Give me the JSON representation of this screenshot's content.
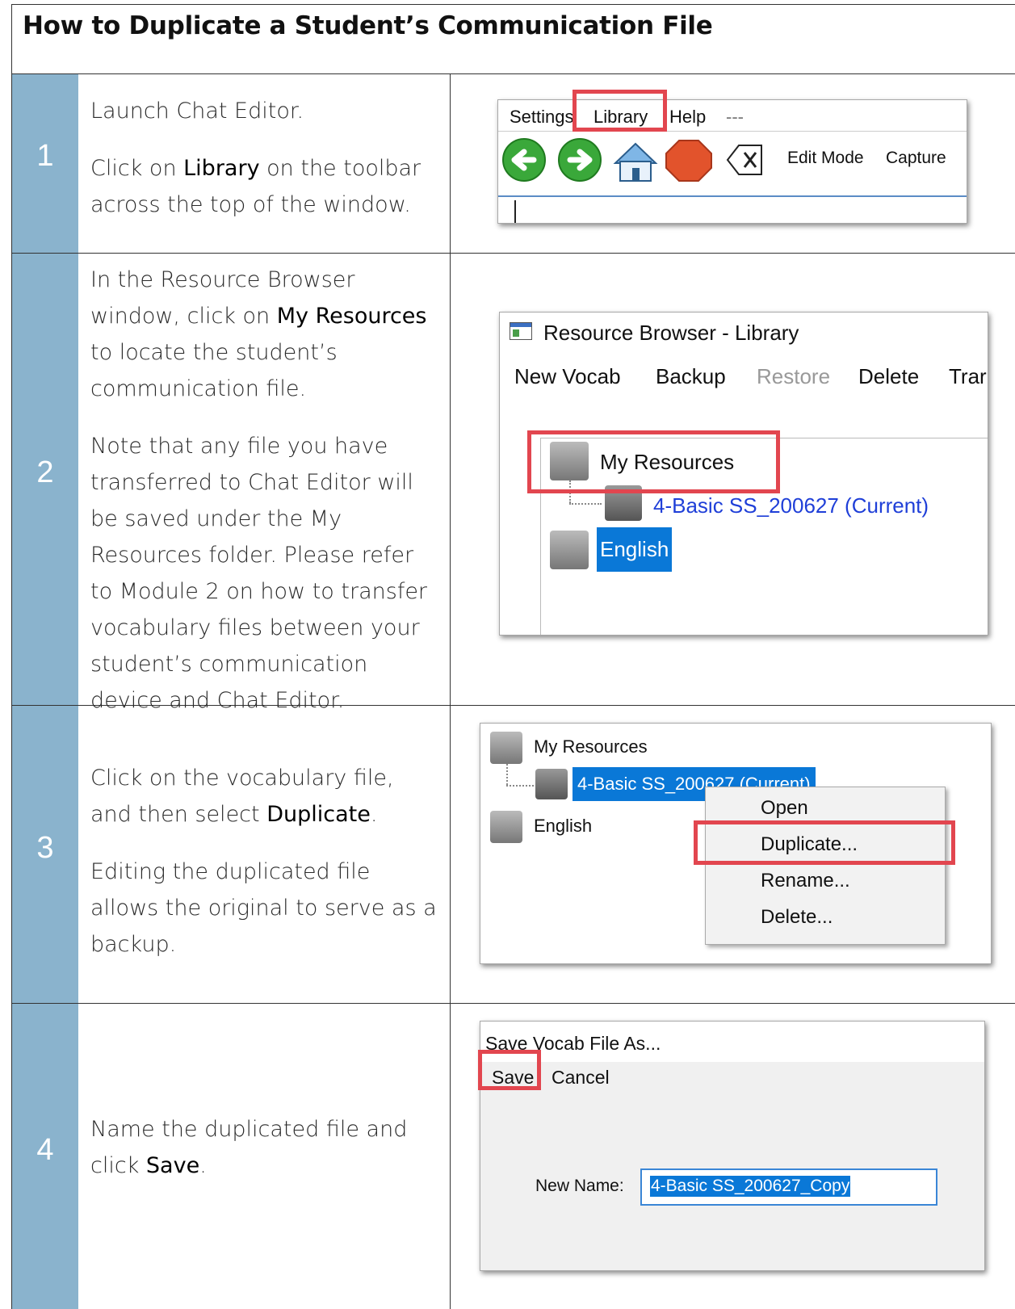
{
  "title": "How to Duplicate a Student’s Communication File",
  "steps": [
    {
      "number": "1",
      "paragraphs": [
        {
          "parts": [
            "Launch Chat Editor."
          ]
        },
        {
          "before": "Click on ",
          "bold": "Library",
          "after": " on the toolbar across the top of the window."
        }
      ],
      "shot": {
        "menu": [
          "Settings",
          "Library",
          "Help",
          "---"
        ],
        "toolbar": [
          "Edit Mode",
          "Capture"
        ]
      }
    },
    {
      "number": "2",
      "paragraphs": [
        {
          "before": "In the Resource Browser window, click on ",
          "bold": "My Resources",
          "after": " to locate the student’s communication file."
        },
        {
          "before": "Note that any file you have transferred to Chat Editor will be saved under the My Resources folder. Please refer to Module 2 on how to transfer vocabulary files between your student’s communication device and Chat Editor.",
          "bold": "",
          "after": ""
        }
      ],
      "shot": {
        "window_title": "Resource Browser - Library",
        "menu": [
          "New Vocab",
          "Backup",
          "Restore",
          "Delete",
          "Trar"
        ],
        "tree": [
          "My Resources",
          "4-Basic SS_200627 (Current)",
          "English"
        ]
      }
    },
    {
      "number": "3",
      "paragraphs": [
        {
          "before": "Click on the vocabulary file, and then select ",
          "bold": "Duplicate",
          "after": "."
        },
        {
          "before": "Editing the duplicated file allows the original to serve as a backup.",
          "bold": "",
          "after": ""
        }
      ],
      "shot": {
        "tree": [
          "My Resources",
          "4-Basic SS_200627 (Current)",
          "English"
        ],
        "context_menu": [
          "Open",
          "Duplicate...",
          "Rename...",
          "Delete..."
        ]
      }
    },
    {
      "number": "4",
      "paragraphs": [
        {
          "before": "Name the duplicated file and click ",
          "bold": "Save",
          "after": "."
        }
      ],
      "shot": {
        "window_title": "Save Vocab File As...",
        "buttons": [
          "Save",
          "Cancel"
        ],
        "field_label": "New Name:",
        "field_value": "4-Basic SS_200627_Copy"
      }
    }
  ],
  "colors": {
    "step_column": "#8ab3cd",
    "highlight_box": "#e2464f",
    "selection": "#0a78d7"
  }
}
